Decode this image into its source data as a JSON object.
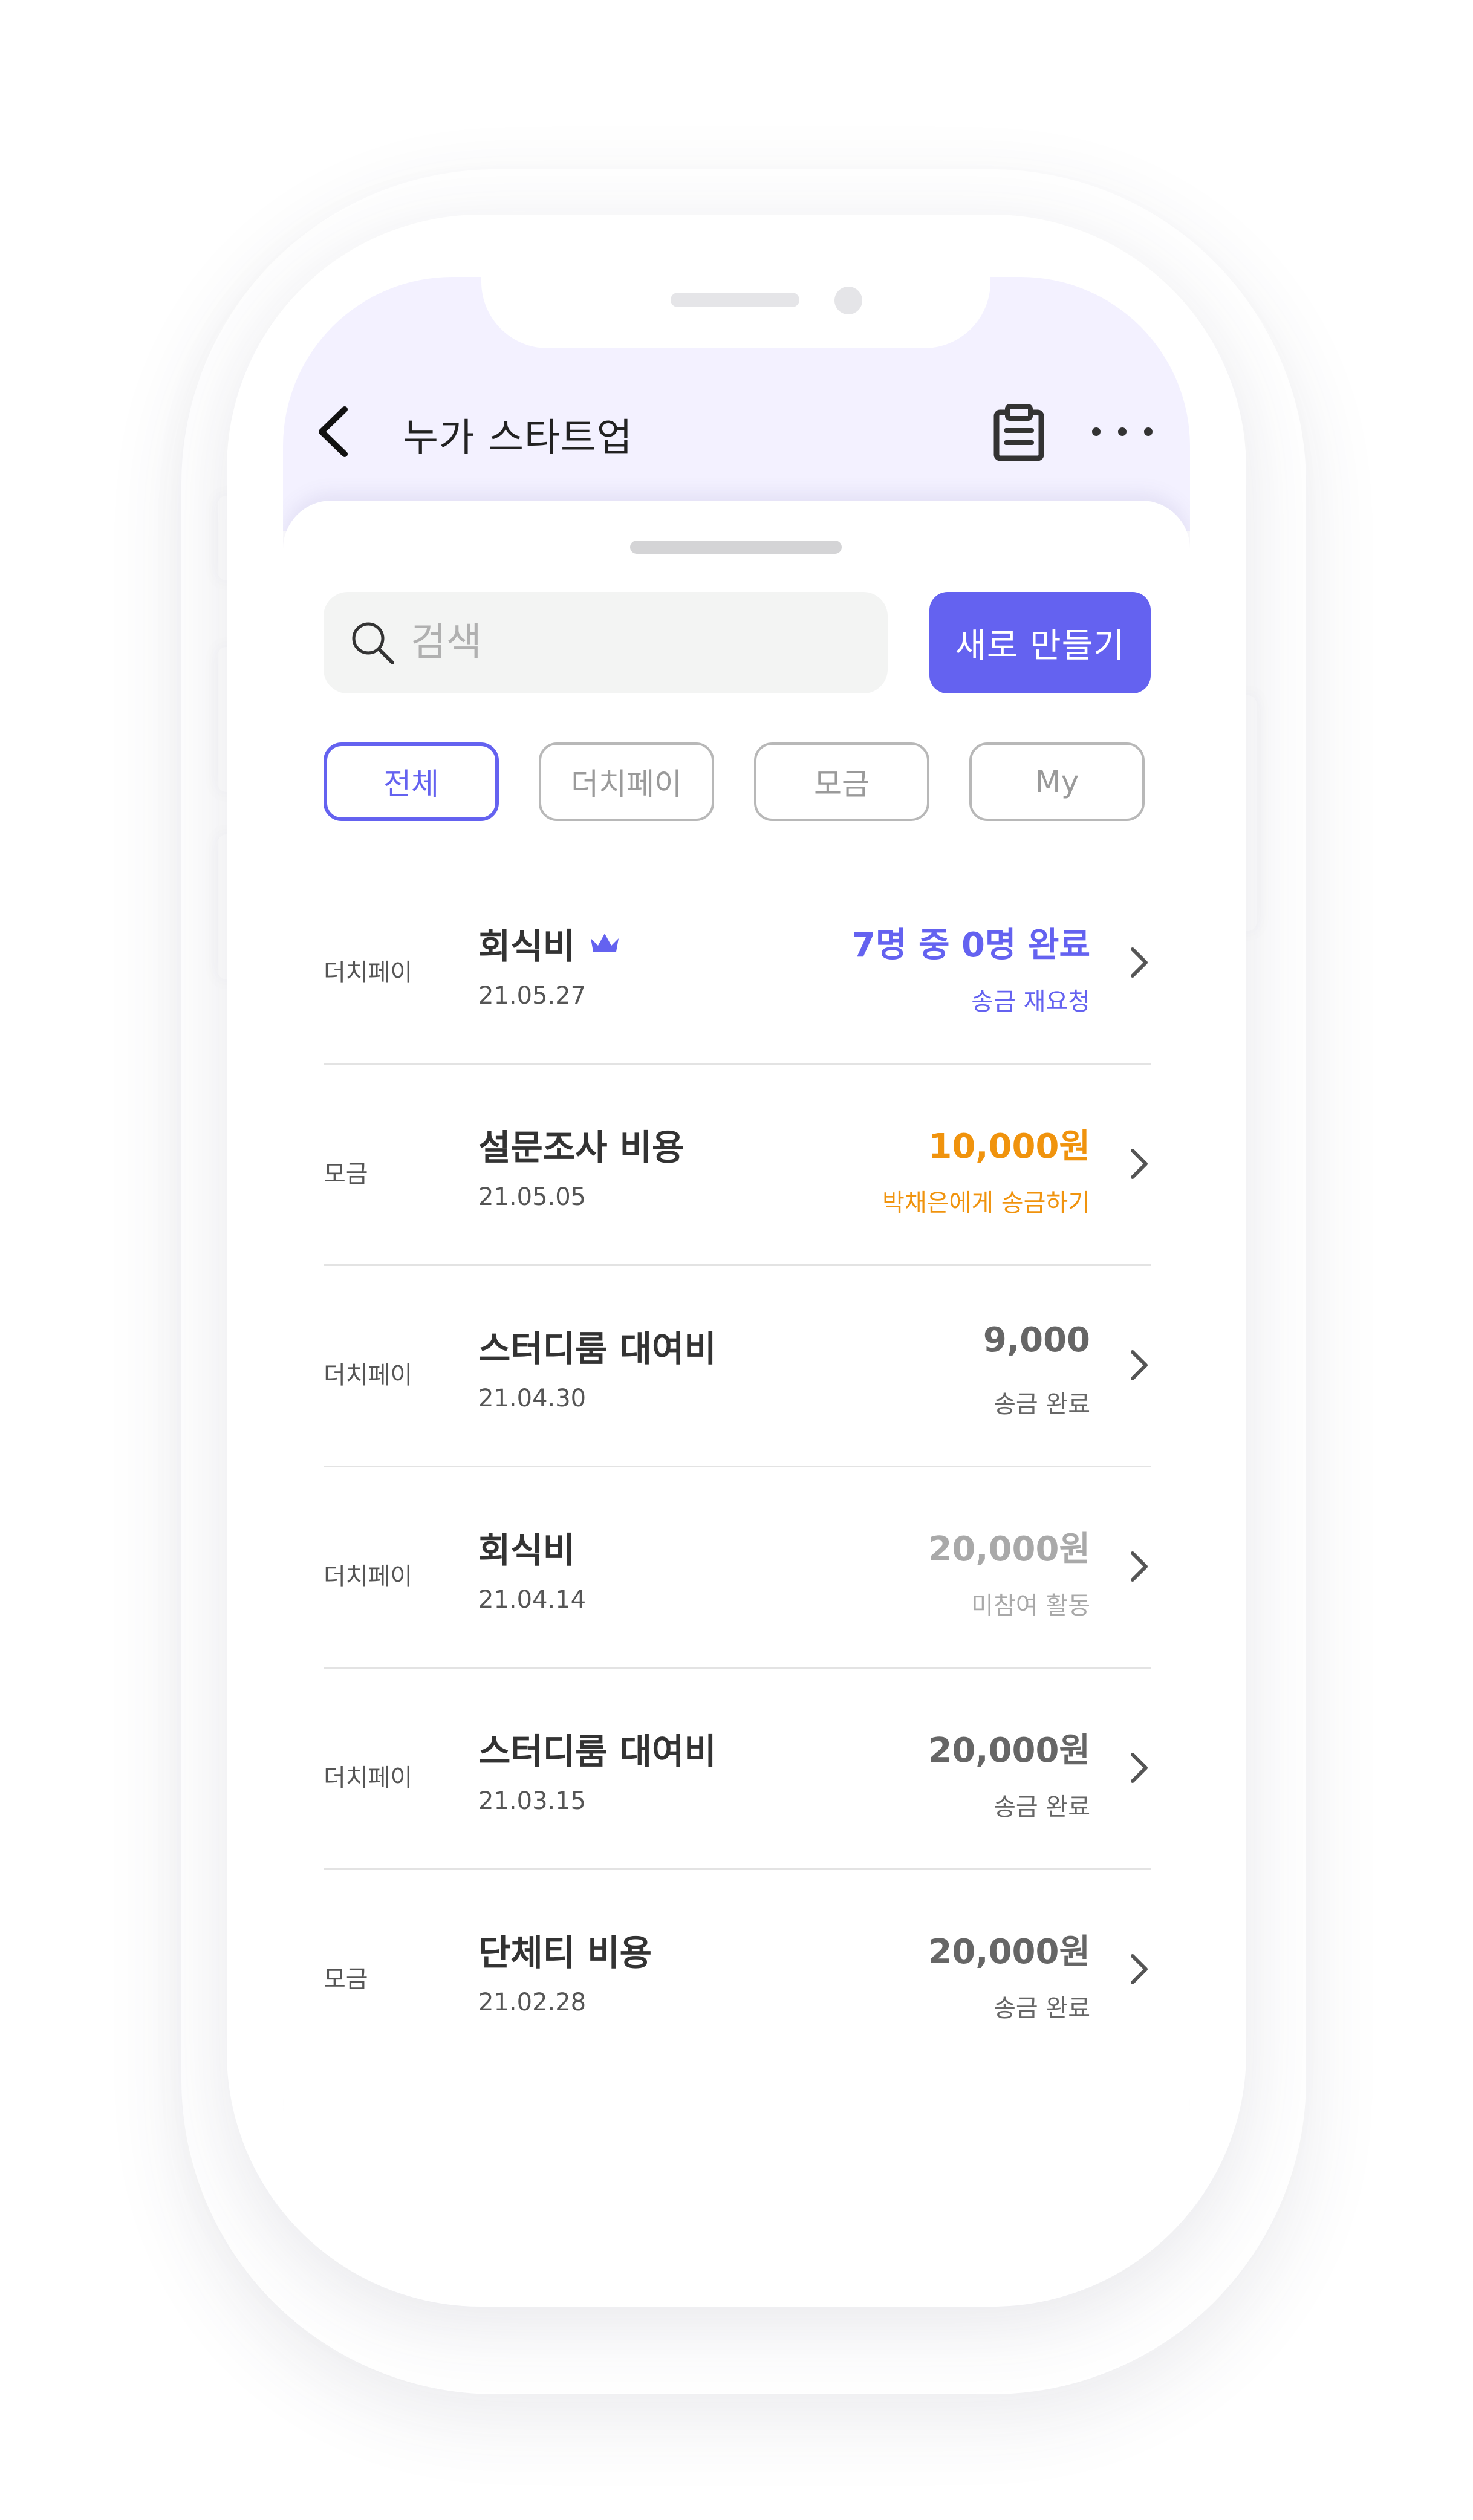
{
  "header": {
    "title": "누가 스타트업"
  },
  "search": {
    "placeholder": "검색"
  },
  "new_button_label": "새로 만들기",
  "tabs": [
    {
      "label": "전체",
      "active": true
    },
    {
      "label": "더치페이",
      "active": false
    },
    {
      "label": "모금",
      "active": false
    },
    {
      "label": "My",
      "active": false
    }
  ],
  "colors": {
    "accent": "#6462f0",
    "orange": "#f0930d",
    "dark": "#666666",
    "muted": "#a9a9a9",
    "header_bg": "#f3f1ff"
  },
  "items": [
    {
      "type": "더치페이",
      "title": "회식비",
      "date": "21.05.27",
      "amount": "7명 중 0명 완료",
      "status": "송금 재요청",
      "crown": true,
      "tone": "accent"
    },
    {
      "type": "모금",
      "title": "설문조사 비용",
      "date": "21.05.05",
      "amount": "10,000원",
      "status": "박채은에게 송금하기",
      "crown": false,
      "tone": "orange"
    },
    {
      "type": "더치페이",
      "title": "스터디룸 대여비",
      "date": "21.04.30",
      "amount": "9,000",
      "status": "송금 완료",
      "crown": false,
      "tone": "dark"
    },
    {
      "type": "더치페이",
      "title": "회식비",
      "date": "21.04.14",
      "amount": "20,000원",
      "status": "미참여 활동",
      "crown": false,
      "tone": "muted"
    },
    {
      "type": "더치페이",
      "title": "스터디룸 대여비",
      "date": "21.03.15",
      "amount": "20,000원",
      "status": "송금 완료",
      "crown": false,
      "tone": "dark"
    },
    {
      "type": "모금",
      "title": "단체티 비용",
      "date": "21.02.28",
      "amount": "20,000원",
      "status": "송금 완료",
      "crown": false,
      "tone": "dark"
    }
  ]
}
